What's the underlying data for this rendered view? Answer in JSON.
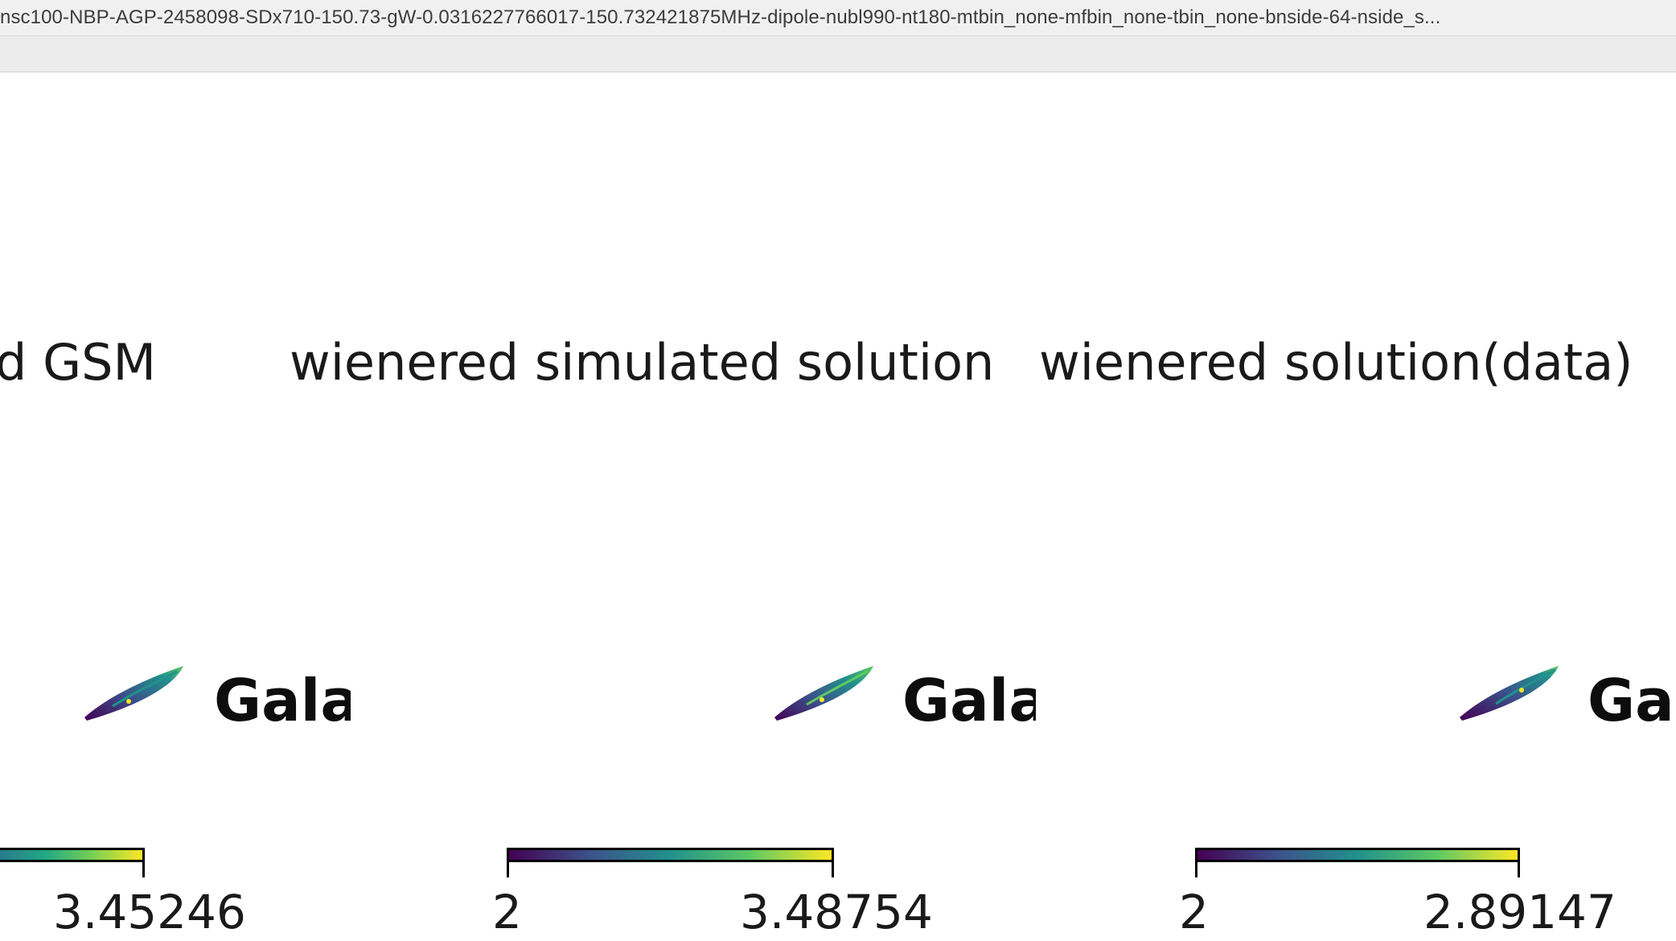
{
  "window": {
    "title": "nsc100-NBP-AGP-2458098-SDx710-150.73-gW-0.0316227766017-150.732421875MHz-dipole-nubl990-nt180-mtbin_none-mfbin_none-tbin_none-bnside-64-nside_s..."
  },
  "panels": [
    {
      "title": "d GSM",
      "projection_label": "Gala",
      "colorbar": {
        "min_label": "",
        "max_label": "3.45246"
      }
    },
    {
      "title": "wienered simulated solution",
      "projection_label": "Gala",
      "colorbar": {
        "min_label": "2",
        "max_label": "3.48754"
      }
    },
    {
      "title": "wienered solution(data)",
      "projection_label": "Ga",
      "colorbar": {
        "min_label": "2",
        "max_label": "2.89147"
      }
    }
  ],
  "colormap": {
    "name": "viridis",
    "stops": [
      "#440154",
      "#3b528b",
      "#21918c",
      "#5ec962",
      "#fde725"
    ]
  }
}
